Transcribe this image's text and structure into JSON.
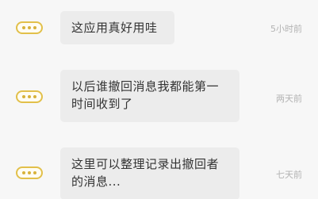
{
  "messages": [
    {
      "icon": "chat-bubble-icon",
      "text": "这应用真好用哇",
      "time": "5小时前"
    },
    {
      "icon": "chat-bubble-icon",
      "text": "以后谁撤回消息我都能第一时间收到了",
      "time": "两天前"
    },
    {
      "icon": "chat-bubble-icon",
      "text": "这里可以整理记录出撤回者的消息...",
      "time": "七天前"
    }
  ],
  "colors": {
    "background": "#f7f7f7",
    "bubble": "#ececec",
    "icon_accent": "#e2c04a",
    "time_text": "#b3b3b3"
  }
}
